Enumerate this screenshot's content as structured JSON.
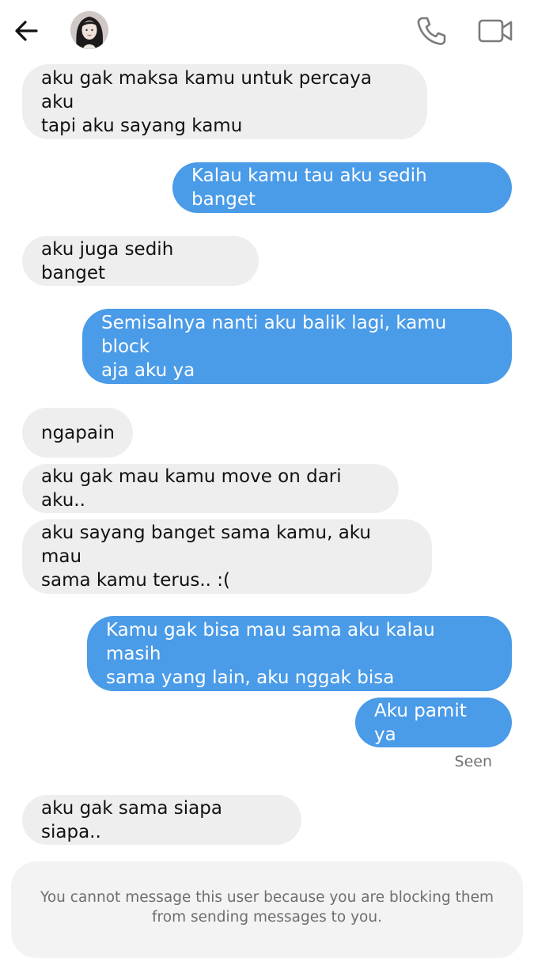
{
  "header": {
    "back_icon": "arrow-left-icon",
    "avatar": "contact-avatar",
    "call_icon": "phone-icon",
    "video_icon": "video-camera-icon"
  },
  "messages": [
    {
      "side": "in",
      "text": "aku gak maksa kamu untuk percaya aku\ntapi aku sayang kamu"
    },
    {
      "side": "out",
      "text": "Kalau kamu tau aku sedih banget"
    },
    {
      "side": "in",
      "text": "aku juga sedih banget"
    },
    {
      "side": "out",
      "text": "Semisalnya nanti aku balik lagi, kamu block\naja aku ya"
    },
    {
      "side": "in",
      "text": "ngapain"
    },
    {
      "side": "in",
      "text": "aku gak mau kamu move on dari aku.."
    },
    {
      "side": "in",
      "text": "aku sayang banget sama kamu, aku mau\nsama kamu terus.. :("
    },
    {
      "side": "out",
      "text": "Kamu gak bisa mau sama aku kalau masih\nsama yang lain, aku nggak bisa"
    },
    {
      "side": "out",
      "text": "Aku pamit ya"
    },
    {
      "side": "in",
      "text": "aku gak sama siapa siapa.."
    }
  ],
  "status": {
    "seen": "Seen"
  },
  "blocked_notice": "You cannot message this user because you are blocking them\nfrom sending messages to you.",
  "colors": {
    "incoming_bubble": "#eeeeee",
    "outgoing_bubble": "#4a9be8",
    "background": "#ffffff"
  }
}
